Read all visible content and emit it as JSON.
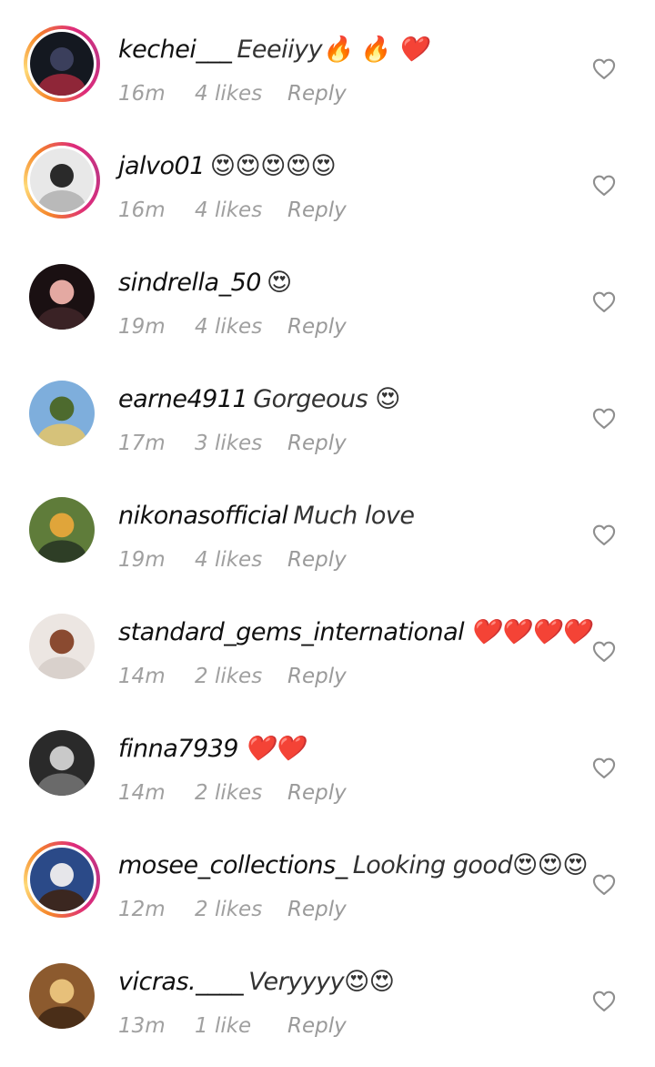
{
  "comments": [
    {
      "username": "kechei___",
      "text": "Eeeiiyy🔥 🔥 ❤️",
      "time": "16m",
      "likes": "4 likes",
      "reply": "Reply",
      "story_ring": true,
      "avatar_colors": [
        "#141820",
        "#3b3f5c",
        "#8f2638"
      ]
    },
    {
      "username": "jalvo01",
      "text": "😍😍😍😍😍",
      "time": "16m",
      "likes": "4 likes",
      "reply": "Reply",
      "story_ring": true,
      "avatar_colors": [
        "#e8e8e8",
        "#2a2a2a",
        "#b9b9b9"
      ]
    },
    {
      "username": "sindrella_50",
      "text": "😍",
      "time": "19m",
      "likes": "4 likes",
      "reply": "Reply",
      "story_ring": false,
      "avatar_colors": [
        "#1a1012",
        "#e4a9a2",
        "#3a2225"
      ]
    },
    {
      "username": "earne4911",
      "text": "Gorgeous 😍",
      "time": "17m",
      "likes": "3 likes",
      "reply": "Reply",
      "story_ring": false,
      "avatar_colors": [
        "#7eaedc",
        "#4d6a2e",
        "#d6c27a"
      ]
    },
    {
      "username": "nikonasofficial",
      "text": "Much love",
      "time": "19m",
      "likes": "4 likes",
      "reply": "Reply",
      "story_ring": false,
      "avatar_colors": [
        "#5f7c3a",
        "#e0a53a",
        "#2e3e26"
      ]
    },
    {
      "username": "standard_gems_international",
      "text": "❤️❤️❤️❤️",
      "time": "14m",
      "likes": "2 likes",
      "reply": "Reply",
      "story_ring": false,
      "avatar_colors": [
        "#ece6e2",
        "#8a4a30",
        "#d9d1cc"
      ]
    },
    {
      "username": "finna7939",
      "text": "❤️❤️",
      "time": "14m",
      "likes": "2 likes",
      "reply": "Reply",
      "story_ring": false,
      "avatar_colors": [
        "#2a2a2a",
        "#c9c9c9",
        "#6a6a6a"
      ]
    },
    {
      "username": "mosee_collections_",
      "text": "Looking good😍😍😍",
      "time": "12m",
      "likes": "2 likes",
      "reply": "Reply",
      "story_ring": true,
      "avatar_colors": [
        "#2b4a88",
        "#e6e6ea",
        "#3b2720"
      ]
    },
    {
      "username": "vicras.____",
      "text": "Veryyyy😍😍",
      "time": "13m",
      "likes": "1 like",
      "reply": "Reply",
      "story_ring": false,
      "avatar_colors": [
        "#8c5a2e",
        "#e7c07a",
        "#4a2e18"
      ]
    }
  ],
  "icons": {
    "like": "heart-outline-icon"
  },
  "colors": {
    "meta": "#a0a0a0",
    "heart_stroke": "#8e8e8e"
  }
}
